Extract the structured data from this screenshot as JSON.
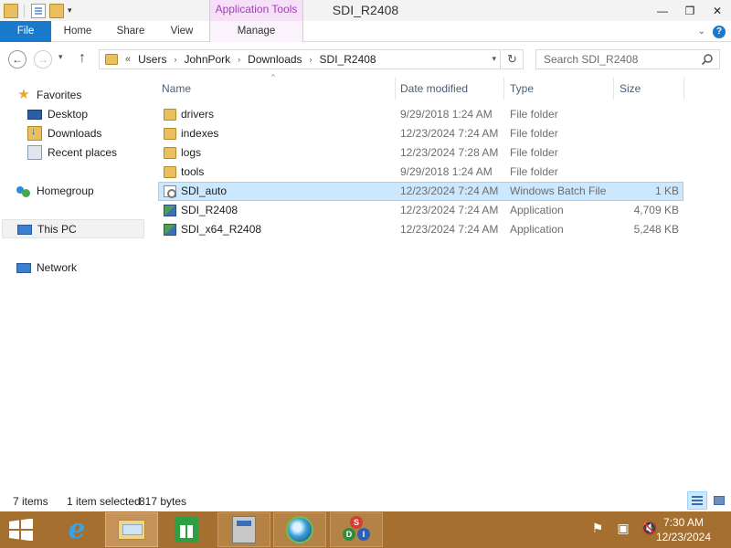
{
  "window": {
    "title": "SDI_R2408",
    "contextual_group": "Application Tools",
    "minimize_glyph": "—",
    "maximize_glyph": "❐",
    "close_glyph": "✕"
  },
  "ribbon": {
    "tabs": [
      {
        "label": "File"
      },
      {
        "label": "Home"
      },
      {
        "label": "Share"
      },
      {
        "label": "View"
      },
      {
        "label": "Manage"
      }
    ],
    "collapse_glyph": "⌄",
    "help_glyph": "?"
  },
  "address": {
    "lead_glyph": "«",
    "crumbs": [
      "Users",
      "JohnPork",
      "Downloads",
      "SDI_R2408"
    ],
    "separator_glyph": "›"
  },
  "search": {
    "placeholder": "Search SDI_R2408"
  },
  "nav": {
    "items": [
      {
        "label": "Favorites",
        "icon": "star-icon"
      },
      {
        "label": "Desktop",
        "icon": "desktop-icon"
      },
      {
        "label": "Downloads",
        "icon": "downloads-icon"
      },
      {
        "label": "Recent places",
        "icon": "recent-places-icon"
      },
      {
        "label": "Homegroup",
        "icon": "homegroup-icon"
      },
      {
        "label": "This PC",
        "icon": "this-pc-icon"
      },
      {
        "label": "Network",
        "icon": "network-icon"
      }
    ]
  },
  "columns": {
    "name": "Name",
    "date": "Date modified",
    "type": "Type",
    "size": "Size"
  },
  "files": [
    {
      "name": "drivers",
      "date": "9/29/2018 1:24 AM",
      "type": "File folder",
      "size": "",
      "icon": "folder-icon"
    },
    {
      "name": "indexes",
      "date": "12/23/2024 7:24 AM",
      "type": "File folder",
      "size": "",
      "icon": "folder-icon"
    },
    {
      "name": "logs",
      "date": "12/23/2024 7:28 AM",
      "type": "File folder",
      "size": "",
      "icon": "folder-icon"
    },
    {
      "name": "tools",
      "date": "9/29/2018 1:24 AM",
      "type": "File folder",
      "size": "",
      "icon": "folder-icon"
    },
    {
      "name": "SDI_auto",
      "date": "12/23/2024 7:24 AM",
      "type": "Windows Batch File",
      "size": "1 KB",
      "icon": "batch-file-icon",
      "selected": true
    },
    {
      "name": "SDI_R2408",
      "date": "12/23/2024 7:24 AM",
      "type": "Application",
      "size": "4,709 KB",
      "icon": "application-icon"
    },
    {
      "name": "SDI_x64_R2408",
      "date": "12/23/2024 7:24 AM",
      "type": "Application",
      "size": "5,248 KB",
      "icon": "application-icon"
    }
  ],
  "status": {
    "count": "7 items",
    "selection": "1 item selected",
    "size": "817 bytes"
  },
  "taskbar": {
    "ie_glyph": "e",
    "sdi_letters": [
      "S",
      "D",
      "I"
    ],
    "tray_glyphs": [
      "⚑",
      "▣",
      "🔇"
    ],
    "time": "7:30 AM",
    "date": "12/23/2024"
  },
  "colors": {
    "file_tab": "#1979ca",
    "contextual_tab": "#a43cb9",
    "selection": "#cce8ff",
    "taskbar": "#a56f2f"
  }
}
